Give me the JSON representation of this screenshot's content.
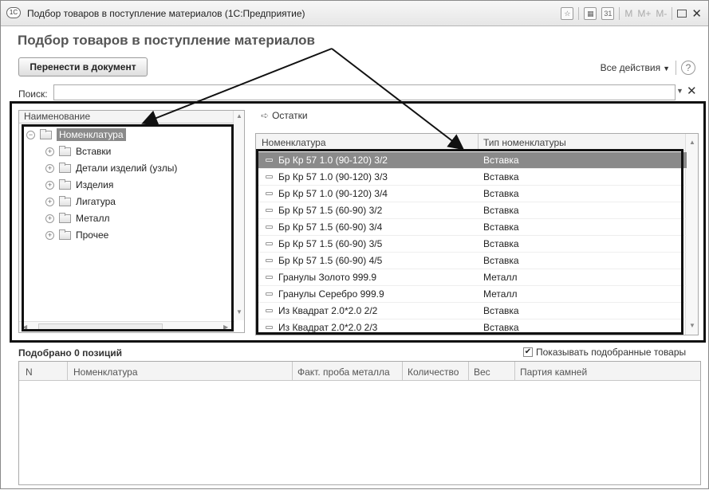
{
  "window": {
    "logo": "1С",
    "title": "Подбор товаров в поступление материалов  (1С:Предприятие)",
    "tb_calc": "▦",
    "tb_cal": "31",
    "tb_m": "M",
    "tb_mplus": "M+",
    "tb_mminus": "M-",
    "tb_close": "✕"
  },
  "page": {
    "title": "Подбор товаров в поступление материалов"
  },
  "toolbar": {
    "transfer_label": "Перенести в документ",
    "all_actions_label": "Все действия",
    "help_label": "?"
  },
  "search": {
    "label": "Поиск:",
    "value": ""
  },
  "tree": {
    "header": "Наименование",
    "root": "Номенклатура",
    "items": [
      "Вставки",
      "Детали изделий (узлы)",
      "Изделия",
      "Лигатура",
      "Металл",
      "Прочее"
    ]
  },
  "ostatki_label": "Остатки",
  "table": {
    "col_name": "Номенклатура",
    "col_type": "Тип номенклатуры",
    "rows": [
      {
        "name": "Бр Кр 57 1.0 (90-120) 3/2",
        "type": "Вставка"
      },
      {
        "name": "Бр Кр 57 1.0 (90-120) 3/3",
        "type": "Вставка"
      },
      {
        "name": "Бр Кр 57 1.0 (90-120) 3/4",
        "type": "Вставка"
      },
      {
        "name": "Бр Кр 57 1.5 (60-90) 3/2",
        "type": "Вставка"
      },
      {
        "name": "Бр Кр 57 1.5 (60-90) 3/4",
        "type": "Вставка"
      },
      {
        "name": "Бр Кр 57 1.5 (60-90) 3/5",
        "type": "Вставка"
      },
      {
        "name": "Бр Кр 57 1.5 (60-90) 4/5",
        "type": "Вставка"
      },
      {
        "name": "Гранулы Золото 999.9",
        "type": "Металл"
      },
      {
        "name": "Гранулы Серебро 999.9",
        "type": "Металл"
      },
      {
        "name": "Из Квадрат 2.0*2.0 2/2",
        "type": "Вставка"
      },
      {
        "name": "Из Квадрат 2.0*2.0 2/3",
        "type": "Вставка"
      }
    ]
  },
  "picked": {
    "label": "Подобрано 0 позиций",
    "show_label": "Показывать подобранные товары"
  },
  "bottom_table": {
    "headers": [
      "N",
      "Номенклатура",
      "Факт. проба металла",
      "Количество",
      "Вес",
      "Партия камней"
    ]
  }
}
